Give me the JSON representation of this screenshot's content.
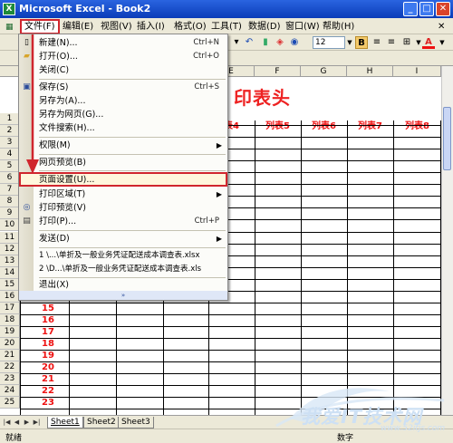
{
  "window": {
    "title": "Microsoft Excel - Book2",
    "app_icon": "X"
  },
  "menubar": [
    {
      "label": "文件(F)"
    },
    {
      "label": "编辑(E)"
    },
    {
      "label": "视图(V)"
    },
    {
      "label": "插入(I)"
    },
    {
      "label": "格式(O)"
    },
    {
      "label": "工具(T)"
    },
    {
      "label": "数据(D)"
    },
    {
      "label": "窗口(W)"
    },
    {
      "label": "帮助(H)"
    }
  ],
  "toolbar": {
    "font_size": "12",
    "bold": "B",
    "font_color_glyph": "A"
  },
  "file_menu": {
    "items": [
      {
        "label": "新建(N)...",
        "shortcut": "Ctrl+N",
        "icon": "new-file-icon"
      },
      {
        "label": "打开(O)...",
        "shortcut": "Ctrl+O",
        "icon": "open-folder-icon"
      },
      {
        "label": "关闭(C)",
        "shortcut": ""
      },
      {
        "label": "保存(S)",
        "shortcut": "Ctrl+S",
        "icon": "save-icon"
      },
      {
        "label": "另存为(A)...",
        "shortcut": ""
      },
      {
        "label": "另存为网页(G)...",
        "shortcut": ""
      },
      {
        "label": "文件搜索(H)...",
        "shortcut": ""
      },
      {
        "label": "权限(M)",
        "shortcut": ""
      },
      {
        "label": "网页预览(B)",
        "shortcut": ""
      },
      {
        "label": "页面设置(U)...",
        "shortcut": ""
      },
      {
        "label": "打印区域(T)",
        "shortcut": ""
      },
      {
        "label": "打印预览(V)",
        "shortcut": "",
        "icon": "print-preview-icon"
      },
      {
        "label": "打印(P)...",
        "shortcut": "Ctrl+P",
        "icon": "printer-icon"
      },
      {
        "label": "发送(D)",
        "shortcut": ""
      },
      {
        "label": "1 \\...\\单折及一般业务凭证配送成本调查表.xlsx",
        "shortcut": ""
      },
      {
        "label": "2 \\D...\\单折及一般业务凭证配送成本调查表.xls",
        "shortcut": ""
      },
      {
        "label": "退出(X)",
        "shortcut": ""
      }
    ],
    "expand_glyph": "»"
  },
  "sheet": {
    "banner": "印表头",
    "columns": [
      "E",
      "F",
      "G",
      "H",
      "I"
    ],
    "row_numbers": [
      "1",
      "2",
      "3",
      "4",
      "5",
      "6",
      "7",
      "8",
      "9",
      "10",
      "11",
      "12",
      "13",
      "14",
      "15",
      "16",
      "17",
      "18",
      "19",
      "20",
      "21",
      "22",
      "23",
      "24",
      "25"
    ],
    "header_cells": [
      "表4",
      "列表5",
      "列表6",
      "列表7",
      "列表8"
    ],
    "numbers": [
      "15",
      "16",
      "17",
      "18",
      "19",
      "20",
      "21",
      "22",
      "23"
    ]
  },
  "tabs": [
    "Sheet1",
    "Sheet2",
    "Sheet3"
  ],
  "status": {
    "left": "就绪",
    "right": "数字"
  },
  "watermark": {
    "text": "我爱IT技术网",
    "url": "www.52itjs.com"
  }
}
